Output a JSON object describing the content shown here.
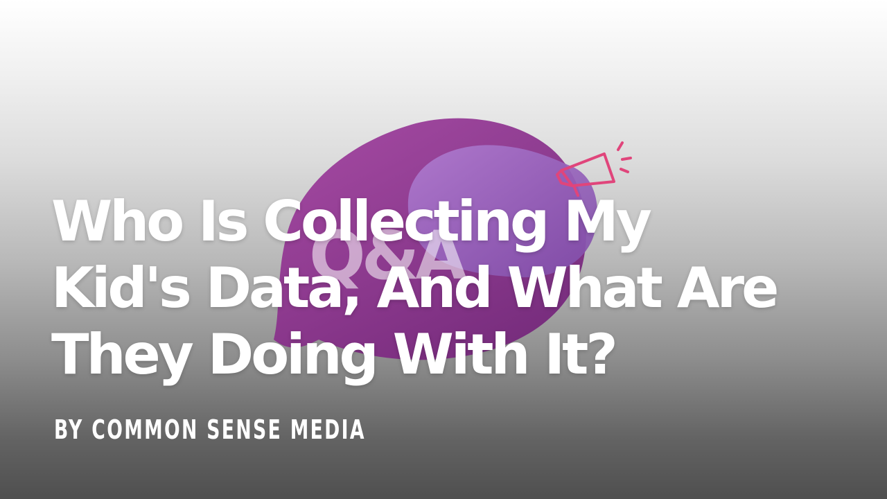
{
  "article": {
    "title_lines": [
      "Who Is Collecting My",
      "Kid's Data, And What Are",
      "They Doing With It?"
    ],
    "byline": "BY COMMON SENSE MEDIA"
  },
  "logo": {
    "text": "Q&A",
    "icon": "megaphone-icon",
    "colors": {
      "bubble_main": "#8b2a8f",
      "bubble_secondary": "#9a62b9",
      "accent": "#e0457b"
    }
  }
}
